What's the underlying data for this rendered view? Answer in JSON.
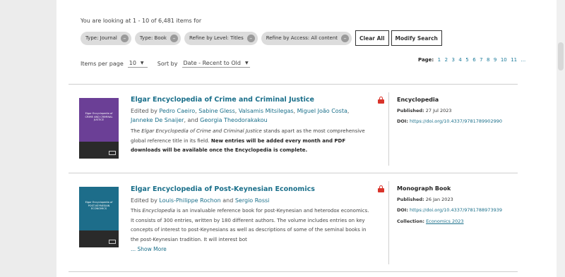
{
  "summary": "You are looking at 1 - 10 of 6,481 items for",
  "filters": [
    {
      "label": "Type: Journal"
    },
    {
      "label": "Type: Book"
    },
    {
      "label": "Refine by Level: Titles"
    },
    {
      "label": "Refine by Access: All content"
    }
  ],
  "buttons": {
    "clear_all": "Clear All",
    "modify_search": "Modify Search"
  },
  "controls": {
    "items_per_page_label": "Items per page",
    "items_per_page_value": "10",
    "sort_label": "Sort by",
    "sort_value": "Date - Recent to Old"
  },
  "pagination": {
    "label": "Page:",
    "pages": [
      "1",
      "2",
      "3",
      "4",
      "5",
      "6",
      "7",
      "8",
      "9",
      "10",
      "11"
    ],
    "ellipsis": "..."
  },
  "results": [
    {
      "title": "Elgar Encyclopedia of Crime and Criminal Justice",
      "edited_by": "Edited by",
      "editors": [
        "Pedro Caeiro",
        "Sabine Gless",
        "Valsamis Mitsilegas",
        "Miguel João Costa",
        "Janneke De Snaijer",
        "Georgia Theodorakakou"
      ],
      "sep_comma": ",",
      "sep_and": ", and",
      "abstract_1": "The",
      "abstract_italic": "Elgar Encyclopedia of Crime and Criminal Justice",
      "abstract_2": "stands apart as the most comprehensive global reference title in its field.",
      "abstract_bold": "New entries will be added every month and PDF downloads will be available once the Encyclopedia is complete.",
      "cover_text": "Elgar Encyclopedia of CRIME AND CRIMINAL JUSTICE",
      "cover_color": "#6b3f96",
      "type": "Encyclopedia",
      "published_label": "Published:",
      "published": "27 Jul 2023",
      "doi_label": "DOI:",
      "doi": "https://doi.org/10.4337/9781789902990"
    },
    {
      "title": "Elgar Encyclopedia of Post-Keynesian Economics",
      "edited_by": "Edited by",
      "editors": [
        "Louis-Philippe Rochon",
        "Sergio Rossi"
      ],
      "sep_and": "and",
      "abstract_1": "This",
      "abstract_italic": "Encyclopedia",
      "abstract_2": "is an invaluable reference book for post-Keynesian and heterodox economics. It consists of 300 entries, written by 180 different authors. The volume includes entries on key concepts of interest to post-Keynesians as well as descriptions of some of the seminal books in the post-Keynesian tradition. It will interest bot",
      "show_more": "... Show More",
      "cover_text": "Elgar Encyclopedia of POST-KEYNESIAN ECONOMICS",
      "cover_color": "#1d6d8a",
      "type": "Monograph Book",
      "published_label": "Published:",
      "published": "26 Jan 2023",
      "doi_label": "DOI:",
      "doi": "https://doi.org/10.4337/9781788973939",
      "collection_label": "Collection:",
      "collection": "Economics 2023"
    }
  ],
  "colors": {
    "link": "#1a6f8a",
    "lock": "#d9342b"
  }
}
